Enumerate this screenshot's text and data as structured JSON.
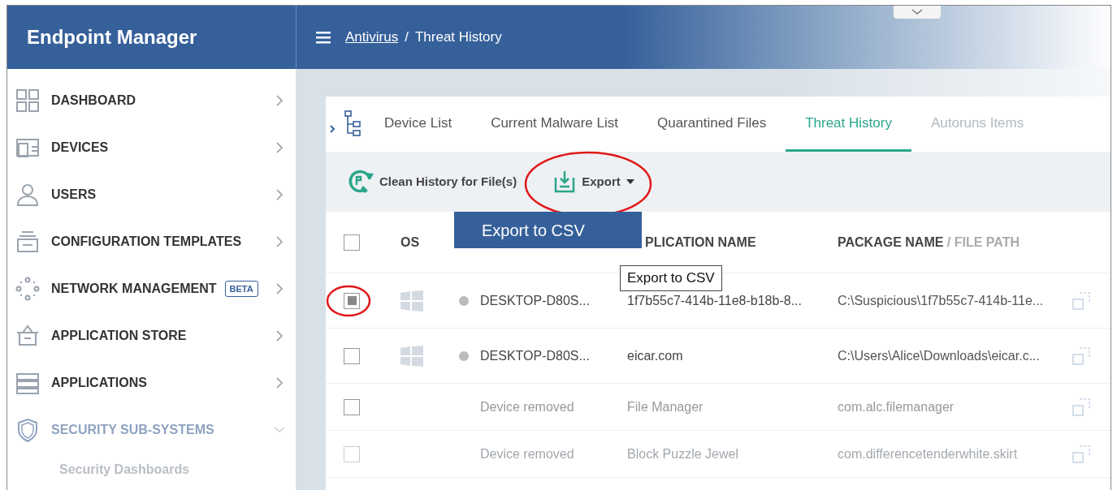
{
  "brand": "Endpoint Manager",
  "breadcrumb": [
    {
      "label": "Antivirus",
      "link": true
    },
    {
      "label": "/",
      "link": false
    },
    {
      "label": "Threat History",
      "link": false
    }
  ],
  "sidebar": {
    "items": [
      {
        "label": "DASHBOARD",
        "expanded": false
      },
      {
        "label": "DEVICES",
        "expanded": false
      },
      {
        "label": "USERS",
        "expanded": false
      },
      {
        "label": "CONFIGURATION TEMPLATES",
        "expanded": false
      },
      {
        "label": "NETWORK MANAGEMENT",
        "badge": "BETA",
        "expanded": false
      },
      {
        "label": "APPLICATION STORE",
        "expanded": false
      },
      {
        "label": "APPLICATIONS",
        "expanded": false
      },
      {
        "label": "SECURITY SUB-SYSTEMS",
        "expanded": true,
        "children": [
          {
            "label": "Security Dashboards"
          }
        ]
      }
    ]
  },
  "tabs": [
    {
      "label": "Device List",
      "selected": false
    },
    {
      "label": "Current Malware List",
      "selected": false
    },
    {
      "label": "Quarantined Files",
      "selected": false
    },
    {
      "label": "Threat History",
      "selected": true
    },
    {
      "label": "Autoruns Items",
      "selected": false
    }
  ],
  "toolbar": [
    {
      "label": "Clean History for File(s)",
      "kind": "clean",
      "annotated": false
    },
    {
      "label": "Export",
      "kind": "export",
      "annotated": true
    }
  ],
  "export_menu": {
    "items": [
      "Export to CSV"
    ]
  },
  "tooltip": "Export to CSV",
  "table": {
    "select_all": {
      "checked": false
    },
    "columns": [
      "OS",
      "PLICATION NAME",
      "PACKAGE NAME / FILE PATH"
    ],
    "rows": [
      {
        "checked": true,
        "annotated": true,
        "kind": "windows",
        "device": "DESKTOP-D80S...",
        "application": "1f7b55c7-414b-11e8-b18b-8...",
        "path": "C:\\Suspicious\\1f7b55c7-414b-11e..."
      },
      {
        "checked": false,
        "annotated": false,
        "kind": "windows",
        "device": "DESKTOP-D80S...",
        "application": "eicar.com",
        "path": "C:\\Users\\Alice\\Downloads\\eicar.c..."
      },
      {
        "checked": false,
        "annotated": false,
        "kind": "removed",
        "device": "Device removed",
        "application": "File Manager",
        "path": "com.alc.filemanager"
      },
      {
        "checked": false,
        "annotated": false,
        "kind": "removed",
        "device": "Device removed",
        "application": "Block Puzzle Jewel",
        "path": "com.differencetenderwhite.skirt"
      }
    ]
  }
}
